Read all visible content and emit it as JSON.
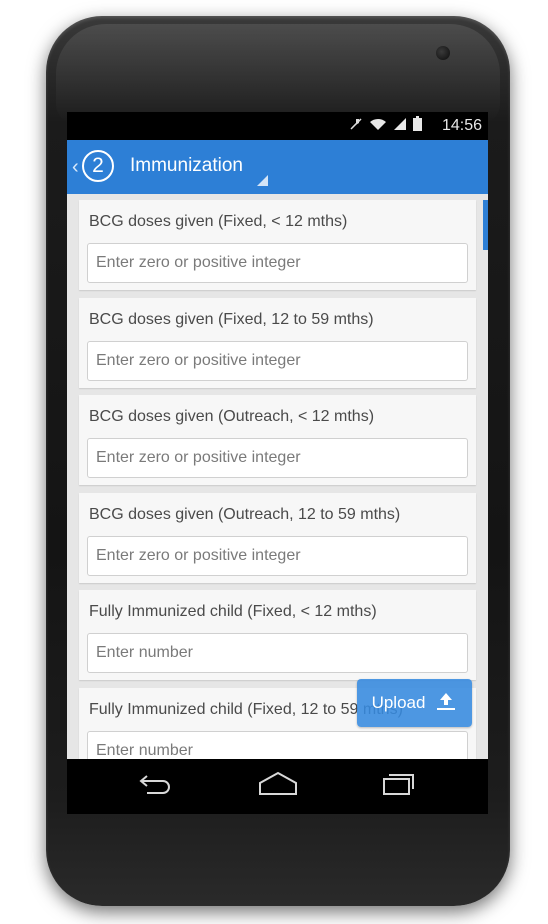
{
  "status_bar": {
    "time": "14:56",
    "icons": [
      "mute-icon",
      "wifi-icon",
      "signal-icon",
      "battery-icon"
    ]
  },
  "action_bar": {
    "badge_number": "2",
    "title": "Immunization",
    "up_glyph": "‹"
  },
  "fields": [
    {
      "label": "BCG doses given (Fixed, < 12 mths)",
      "placeholder": "Enter zero or positive integer"
    },
    {
      "label": "BCG doses given (Fixed, 12 to 59 mths)",
      "placeholder": "Enter zero or positive integer"
    },
    {
      "label": "BCG doses given (Outreach, < 12 mths)",
      "placeholder": "Enter zero or positive integer"
    },
    {
      "label": "BCG doses given (Outreach, 12 to 59 mths)",
      "placeholder": "Enter zero or positive integer"
    },
    {
      "label": "Fully Immunized child (Fixed, < 12 mths)",
      "placeholder": "Enter number"
    },
    {
      "label": "Fully Immunized child (Fixed, 12 to 59 mths)",
      "placeholder": "Enter number"
    }
  ],
  "upload_button": {
    "label": "Upload",
    "icon": "upload-icon"
  },
  "nav_bar": {
    "icons": [
      "back-icon",
      "home-icon",
      "recent-apps-icon"
    ]
  },
  "colors": {
    "accent": "#2d7fd6",
    "content_bg": "#e6e6e6",
    "card_bg": "#f7f7f7"
  }
}
